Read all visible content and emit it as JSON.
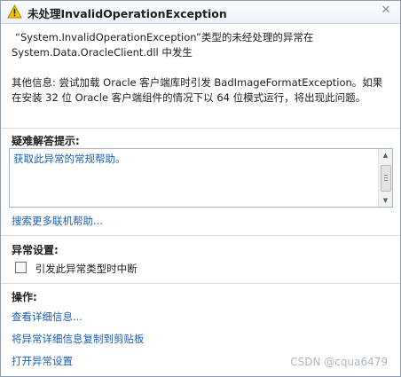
{
  "window": {
    "title": "未处理InvalidOperationException",
    "close_glyph": "✕"
  },
  "message": {
    "line1": "“System.InvalidOperationException”类型的未经处理的异常在",
    "line2": "System.Data.OracleClient.dll 中发生"
  },
  "details": {
    "text": "其他信息: 尝试加载 Oracle 客户端库时引发 BadImageFormatException。如果在安装 32 位 Oracle 客户端组件的情况下以 64 位模式运行，将出现此问题。"
  },
  "troubleshooting": {
    "label": "疑难解答提示:",
    "tip": "获取此异常的常规帮助。",
    "search_link": "搜索更多联机帮助..."
  },
  "exception_settings": {
    "label": "异常设置:",
    "checkbox_label": "引发此异常类型时中断",
    "checked": false
  },
  "actions": {
    "label": "操作:",
    "view_details": "查看详细信息...",
    "copy_details": "将异常详细信息复制到剪贴板",
    "open_settings": "打开异常设置"
  },
  "watermark": "CSDN @cqua6479",
  "colors": {
    "link": "#1a5fb4",
    "warning_icon": "#f5c400"
  }
}
